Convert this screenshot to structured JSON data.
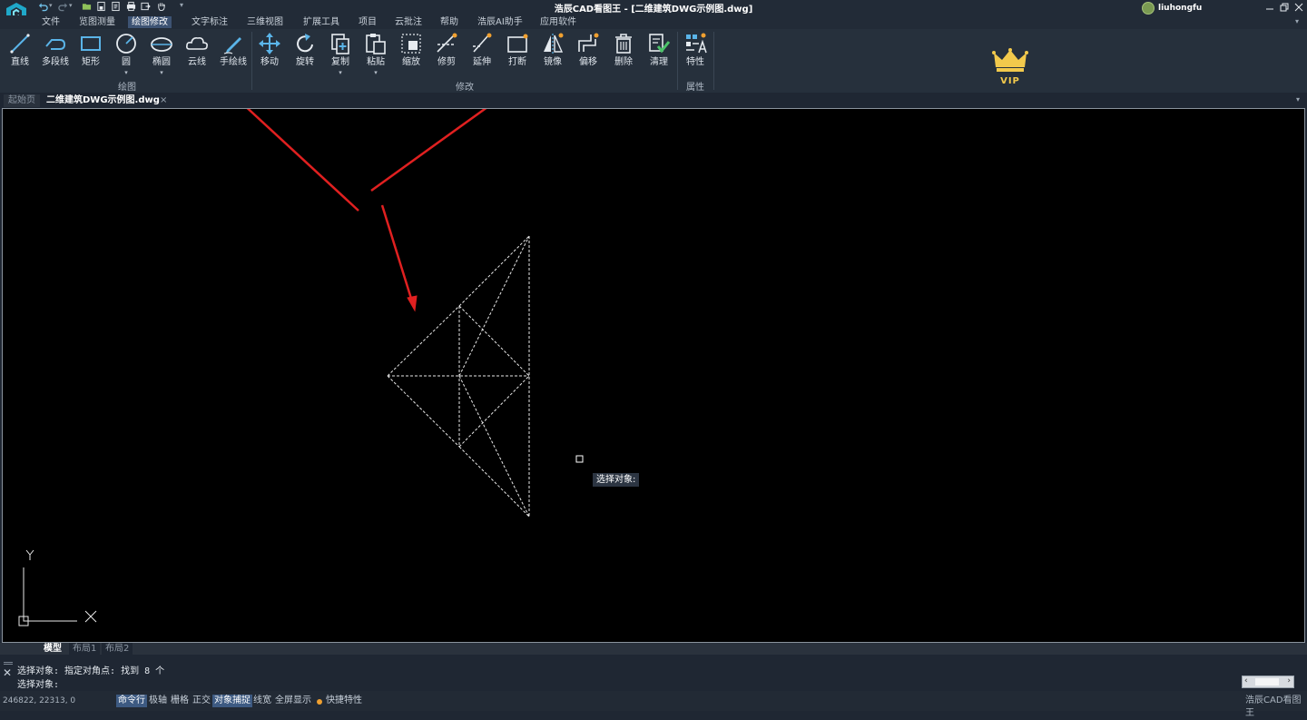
{
  "window": {
    "title": "浩辰CAD看图王 - [二维建筑DWG示例图.dwg]",
    "user": "liuhongfu"
  },
  "quick_access": [
    "undo-icon",
    "redo-icon",
    "open-icon",
    "save-icon",
    "saveas-icon",
    "print-icon",
    "export-icon",
    "pan-hand-icon",
    "customize-icon"
  ],
  "menu": [
    "文件",
    "览图测量",
    "绘图修改",
    "文字标注",
    "三维视图",
    "扩展工具",
    "项目",
    "云批注",
    "帮助",
    "浩辰AI助手",
    "应用软件"
  ],
  "menu_active": "绘图修改",
  "ribbon": {
    "draw_tools": [
      "直线",
      "多段线",
      "矩形",
      "圆",
      "椭圆",
      "云线",
      "手绘线"
    ],
    "modify_tools": [
      "移动",
      "旋转",
      "复制",
      "粘贴",
      "缩放",
      "修剪",
      "延伸",
      "打断",
      "镜像",
      "偏移",
      "删除",
      "清理"
    ],
    "prop_tools": [
      "特性"
    ],
    "groups": {
      "draw": "绘图",
      "modify": "修改",
      "props": "属性"
    },
    "vip": "VIP"
  },
  "doc_tabs": {
    "home": "起始页",
    "active": "二维建筑DWG示例图.dwg",
    "close": "×"
  },
  "canvas": {
    "tooltip": "选择对象:",
    "ucs_x": "X",
    "ucs_y": "Y"
  },
  "layout_tabs": [
    "模型",
    "布局1",
    "布局2"
  ],
  "command": {
    "history": "选择对象: 指定对角点: 找到 8 个",
    "prompt": "选择对象:"
  },
  "status": {
    "coords": "246822, 22313, 0",
    "toggles": [
      {
        "label": "命令行",
        "on": true
      },
      {
        "label": "极轴",
        "on": false
      },
      {
        "label": "栅格",
        "on": false
      },
      {
        "label": "正交",
        "on": false
      },
      {
        "label": "对象捕捉",
        "on": true
      },
      {
        "label": "线宽",
        "on": false
      },
      {
        "label": "全屏显示",
        "on": false
      }
    ],
    "quick_props": "快捷特性",
    "brand": "浩辰CAD看图王"
  },
  "colors": {
    "accent": "#3d5373",
    "annotation_arrow": "#e02020",
    "toggle_on": "#3d5a82"
  }
}
